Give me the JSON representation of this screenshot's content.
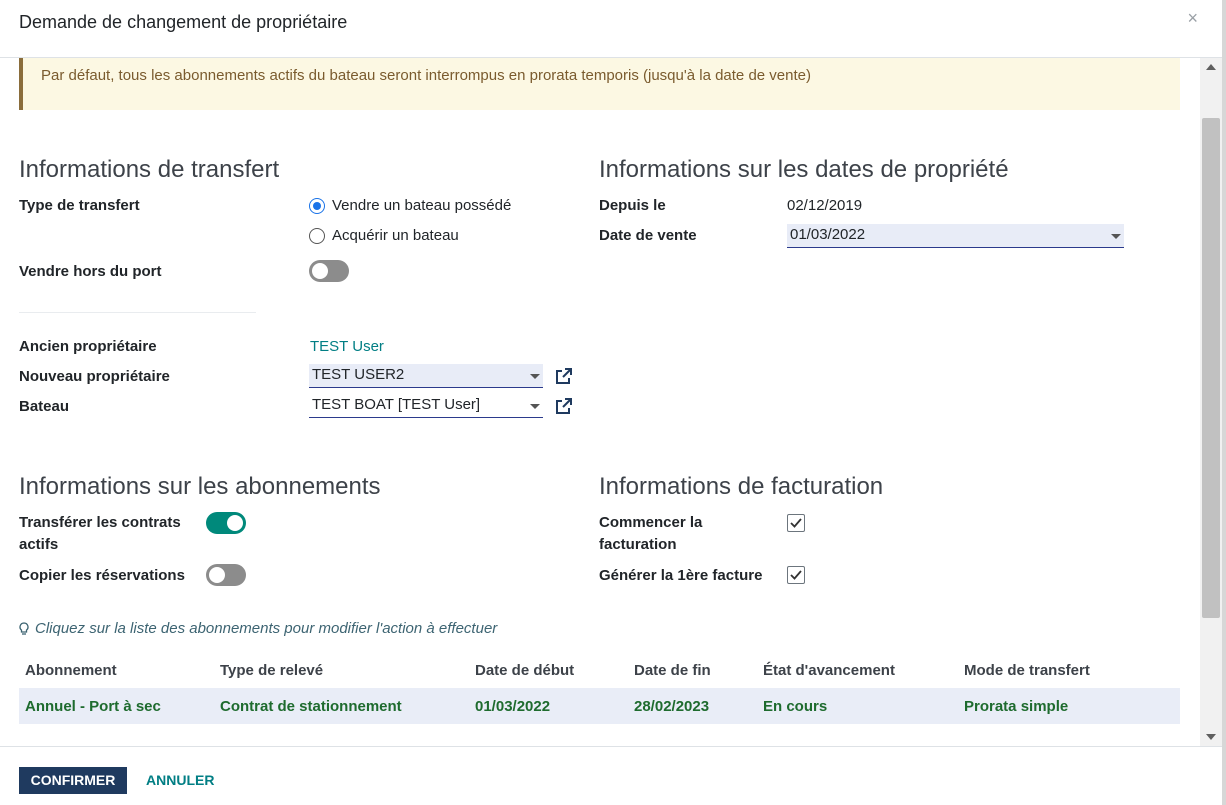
{
  "dialog": {
    "title": "Demande de changement de propriétaire",
    "close": "×"
  },
  "alert": {
    "text": "Par défaut, tous les abonnements actifs du bateau seront interrompus en prorata temporis (jusqu'à la date de vente)"
  },
  "transfer": {
    "title": "Informations de transfert",
    "type_label": "Type de transfert",
    "options": [
      "Vendre un bateau possédé",
      "Acquérir un bateau"
    ],
    "selected_option": "Vendre un bateau possédé",
    "offport_label": "Vendre hors du port",
    "offport_value": false,
    "old_owner_label": "Ancien propriétaire",
    "old_owner_value": "TEST User",
    "new_owner_label": "Nouveau propriétaire",
    "new_owner_value": "TEST USER2",
    "boat_label": "Bateau",
    "boat_value": "TEST BOAT [TEST User]"
  },
  "dates": {
    "title": "Informations sur les dates de propriété",
    "since_label": "Depuis le",
    "since_value": "02/12/2019",
    "sale_label": "Date de vente",
    "sale_value": "01/03/2022"
  },
  "subscriptions": {
    "title": "Informations sur les abonnements",
    "transfer_label_line1": "Transférer les contrats",
    "transfer_label_line2": "actifs",
    "transfer_value": true,
    "copy_label": "Copier les réservations",
    "copy_value": false
  },
  "billing": {
    "title": "Informations de facturation",
    "start_label_line1": "Commencer la",
    "start_label_line2": "facturation",
    "start_value": true,
    "first_invoice_label": "Générer la 1ère facture",
    "first_invoice_value": true
  },
  "hint": {
    "text": "Cliquez sur la liste des abonnements pour modifier l'action à effectuer",
    "icon": "lightbulb-icon"
  },
  "table": {
    "columns": [
      "Abonnement",
      "Type de relevé",
      "Date de début",
      "Date de fin",
      "État d'avancement",
      "Mode de transfert"
    ],
    "rows": [
      [
        "Annuel - Port à sec",
        "Contrat de stationnement",
        "01/03/2022",
        "28/02/2023",
        "En cours",
        "Prorata simple"
      ]
    ]
  },
  "footer": {
    "confirm": "CONFIRMER",
    "cancel": "ANNULER"
  },
  "colors": {
    "primary": "#1f3a5f",
    "accent": "#017e84",
    "toggle_on": "#00897b",
    "row_text": "#1e6b2e",
    "alert_bg": "#fcf8e3"
  }
}
